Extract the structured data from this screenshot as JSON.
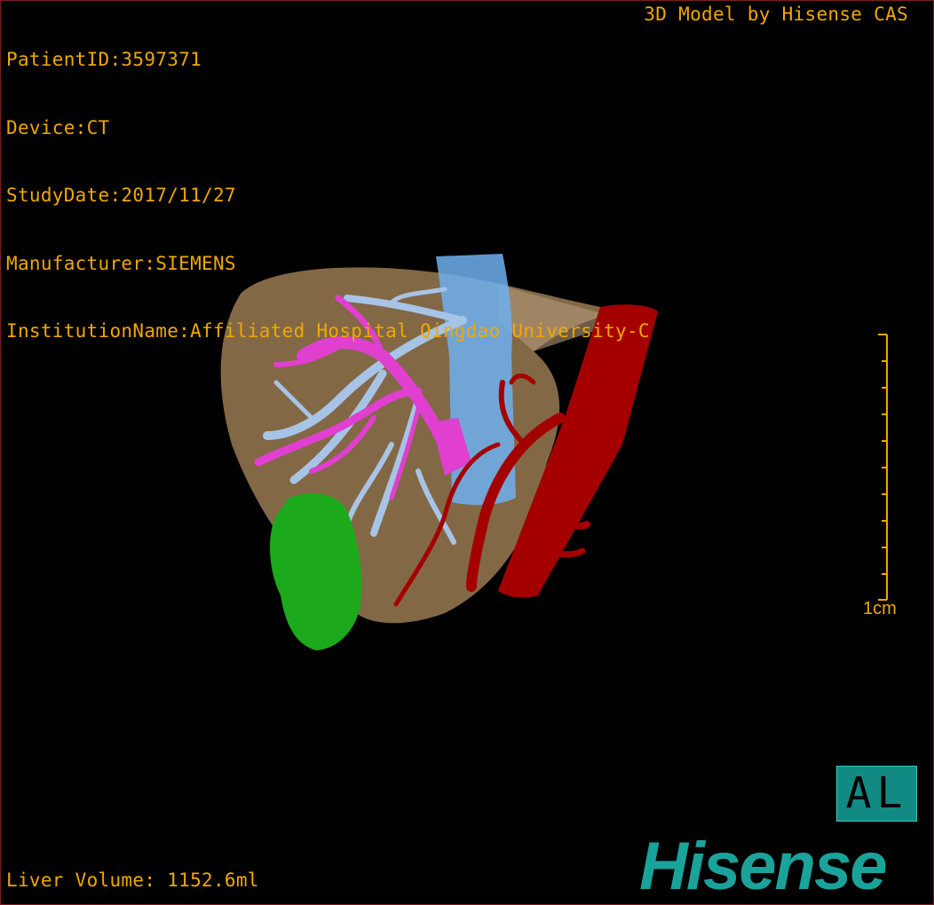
{
  "header": {
    "patient_id": "PatientID:3597371",
    "device": "Device:CT",
    "study_date": "StudyDate:2017/11/27",
    "manufacturer": "Manufacturer:SIEMENS",
    "institution": "InstitutionName:Affiliated Hospital Qingdao University-C"
  },
  "vendor": "3D Model by Hisense CAS",
  "scale": {
    "label": "1cm"
  },
  "orientation": "AL",
  "footer": {
    "volume": "Liver Volume: 1152.6ml"
  },
  "brand": "Hisense",
  "colors": {
    "hud_text": "#f0a800",
    "liver": "#9a7a52",
    "hepatic_vein": "#a7c4e6",
    "portal_vein": "#e03fd0",
    "ivc": "#6fb0f0",
    "aorta": "#a40000",
    "tumor": "#1caa1c",
    "brand": "#1aa39b"
  }
}
